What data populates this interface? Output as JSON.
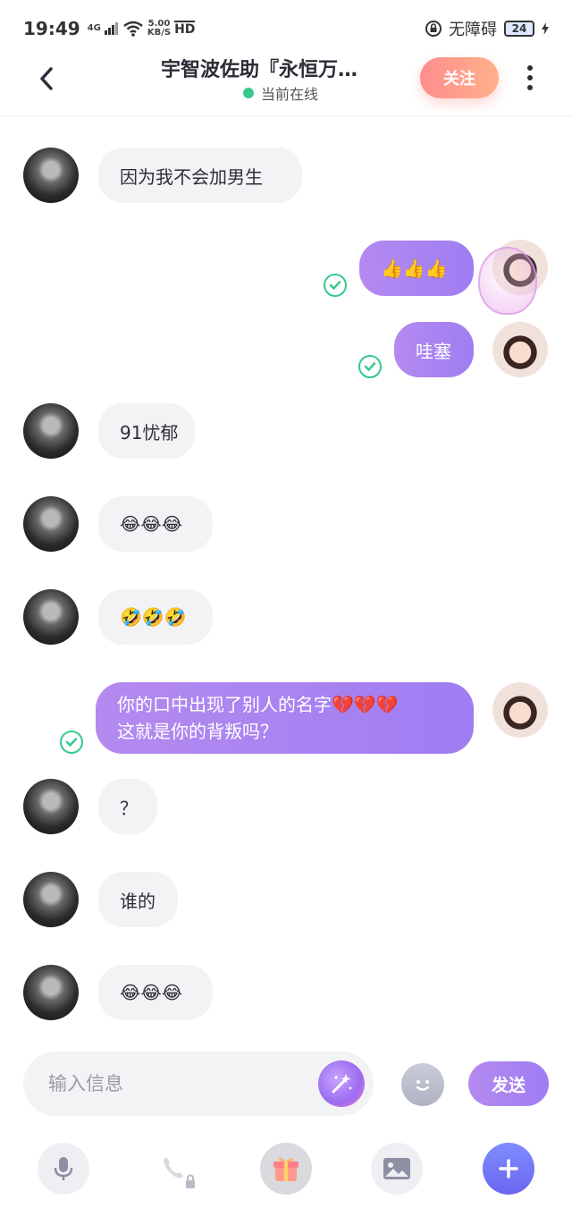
{
  "status_bar": {
    "time": "19:49",
    "network": "4G",
    "speed_value": "5.00",
    "speed_unit": "KB/S",
    "hd": "HD",
    "accessibility": "无障碍",
    "battery": "24"
  },
  "header": {
    "title": "宇智波佐助『永恒万…",
    "status": "当前在线",
    "follow_label": "关注"
  },
  "messages": [
    {
      "side": "in",
      "text": "因为我不会加男生"
    },
    {
      "side": "out",
      "text": "👍👍👍"
    },
    {
      "side": "out",
      "text": "哇塞"
    },
    {
      "side": "in",
      "text": "91忧郁"
    },
    {
      "side": "in",
      "text": "😂😂😂"
    },
    {
      "side": "in",
      "text": "🤣🤣🤣"
    },
    {
      "side": "out",
      "line1": "你的口中出现了别人的名字💔💔💔",
      "line2": "这就是你的背叛吗？"
    },
    {
      "side": "in",
      "text": "？"
    },
    {
      "side": "in",
      "text": "谁的"
    },
    {
      "side": "in",
      "text": "😂😂😂"
    }
  ],
  "composer": {
    "placeholder": "输入信息",
    "send_label": "发送"
  },
  "colors": {
    "accent_purple": "#a57ff2",
    "online_green": "#36c98c",
    "follow_gradient_start": "#ff8d8d",
    "follow_gradient_end": "#ffb08a"
  },
  "icons": {
    "back": "chevron-left-icon",
    "more": "more-vertical-icon",
    "magic": "magic-wand-icon",
    "emoji": "smiley-icon",
    "mic": "microphone-icon",
    "call": "phone-locked-icon",
    "gift": "gift-icon",
    "image": "image-icon",
    "plus": "plus-icon"
  }
}
